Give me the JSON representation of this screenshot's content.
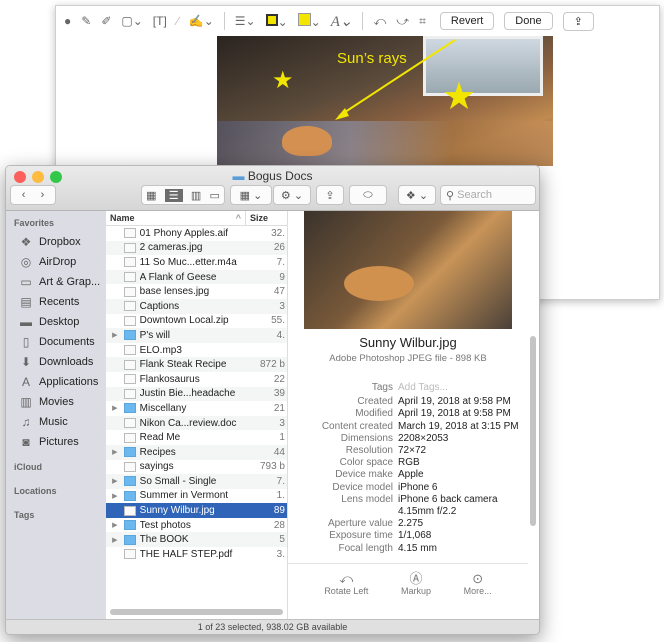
{
  "markup": {
    "tools": [
      "sketch-icon",
      "draw-icon",
      "shapes-icon",
      "text-icon",
      "highlight-icon",
      "sign-icon",
      "line-style-icon",
      "border-color-icon",
      "fill-color-icon",
      "text-style-icon",
      "rotate-left-icon",
      "rotate-right-icon",
      "crop-icon"
    ],
    "revert": "Revert",
    "done": "Done",
    "fill_color": "#f2e600",
    "annotation": "Sun’s rays"
  },
  "finder": {
    "title": "Bogus Docs",
    "search_placeholder": "Search",
    "sidebar": {
      "favorites": "Favorites",
      "items": [
        {
          "label": "Dropbox",
          "icon": "dropbox-icon"
        },
        {
          "label": "AirDrop",
          "icon": "airdrop-icon"
        },
        {
          "label": "Art & Grap...",
          "icon": "folder-icon"
        },
        {
          "label": "Recents",
          "icon": "recents-icon"
        },
        {
          "label": "Desktop",
          "icon": "desktop-icon"
        },
        {
          "label": "Documents",
          "icon": "documents-icon"
        },
        {
          "label": "Downloads",
          "icon": "downloads-icon"
        },
        {
          "label": "Applications",
          "icon": "applications-icon"
        },
        {
          "label": "Movies",
          "icon": "movies-icon"
        },
        {
          "label": "Music",
          "icon": "music-icon"
        },
        {
          "label": "Pictures",
          "icon": "pictures-icon"
        }
      ],
      "icloud": "iCloud",
      "locations": "Locations",
      "tags": "Tags"
    },
    "columns": {
      "name": "Name",
      "size": "Size"
    },
    "files": [
      {
        "name": "01 Phony Apples.aif",
        "size": "32.",
        "folder": false
      },
      {
        "name": "2 cameras.jpg",
        "size": "26",
        "folder": false
      },
      {
        "name": "11 So Muc...etter.m4a",
        "size": "7.",
        "folder": false
      },
      {
        "name": "A Flank of Geese",
        "size": "9",
        "folder": false
      },
      {
        "name": "base lenses.jpg",
        "size": "47",
        "folder": false
      },
      {
        "name": "Captions",
        "size": "3",
        "folder": false
      },
      {
        "name": "Downtown Local.zip",
        "size": "55.",
        "folder": false
      },
      {
        "name": "P's will",
        "size": "4.",
        "folder": true
      },
      {
        "name": "ELO.mp3",
        "size": "",
        "folder": false
      },
      {
        "name": "Flank Steak Recipe",
        "size": "872 b",
        "folder": false
      },
      {
        "name": "Flankosaurus",
        "size": "22",
        "folder": false
      },
      {
        "name": "Justin Bie...headache",
        "size": "39",
        "folder": false
      },
      {
        "name": "Miscellany",
        "size": "21",
        "folder": true
      },
      {
        "name": "Nikon Ca...review.doc",
        "size": "3",
        "folder": false
      },
      {
        "name": "Read Me",
        "size": "1",
        "folder": false
      },
      {
        "name": "Recipes",
        "size": "44",
        "folder": true
      },
      {
        "name": "sayings",
        "size": "793 b",
        "folder": false
      },
      {
        "name": "So Small - Single",
        "size": "7.",
        "folder": true
      },
      {
        "name": "Summer in Vermont",
        "size": "1.",
        "folder": true
      },
      {
        "name": "Sunny Wilbur.jpg",
        "size": "89",
        "folder": false,
        "selected": true
      },
      {
        "name": "Test photos",
        "size": "28",
        "folder": true
      },
      {
        "name": "The BOOK",
        "size": "5",
        "folder": true
      },
      {
        "name": "THE HALF STEP.pdf",
        "size": "3.",
        "folder": false
      }
    ],
    "preview": {
      "name": "Sunny Wilbur.jpg",
      "kind": "Adobe Photoshop JPEG file - 898 KB",
      "info": [
        [
          "Tags",
          "Add Tags..."
        ],
        [
          "Created",
          "April 19, 2018 at 9:58 PM"
        ],
        [
          "Modified",
          "April 19, 2018 at 9:58 PM"
        ],
        [
          "Content created",
          "March 19, 2018 at 3:15 PM"
        ],
        [
          "Dimensions",
          "2208×2053"
        ],
        [
          "Resolution",
          "72×72"
        ],
        [
          "Color space",
          "RGB"
        ],
        [
          "Device make",
          "Apple"
        ],
        [
          "Device model",
          "iPhone 6"
        ],
        [
          "Lens model",
          "iPhone 6 back camera"
        ],
        [
          "",
          "4.15mm f/2.2"
        ],
        [
          "Aperture value",
          "2.275"
        ],
        [
          "Exposure time",
          "1/1,068"
        ],
        [
          "Focal length",
          "4.15 mm"
        ]
      ],
      "actions": [
        "Rotate Left",
        "Markup",
        "More..."
      ]
    },
    "status": "1 of 23 selected, 938.02 GB available"
  }
}
